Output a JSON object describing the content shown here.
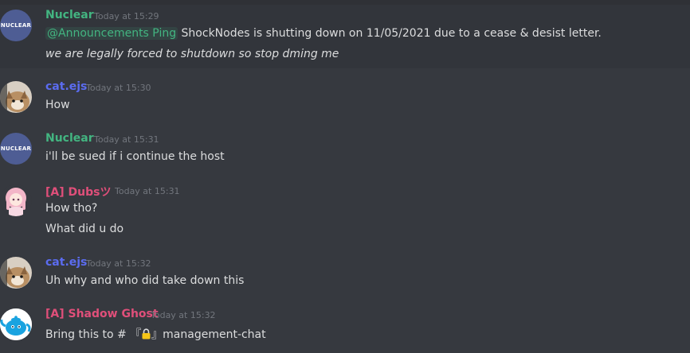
{
  "messages": [
    {
      "author": "Nuclear",
      "author_color": "#43b581",
      "timestamp": "Today at 15:29",
      "avatar_text": "NUCLEAR",
      "mention": "@Announcements Ping",
      "line1": " ShockNodes is shutting down on 11/05/2021 due to a cease & desist letter.",
      "line2": "we are legally forced to shutdown so stop dming me"
    },
    {
      "author": "cat.ejs",
      "author_color": "#5b6cf0",
      "timestamp": "Today at 15:30",
      "line1": "How"
    },
    {
      "author": "Nuclear",
      "author_color": "#43b581",
      "timestamp": "Today at 15:31",
      "avatar_text": "NUCLEAR",
      "line1": "i'll be sued if i continue the host"
    },
    {
      "author": "[A] Dubsツ",
      "author_color": "#e04f7a",
      "timestamp": "Today at 15:31",
      "line1": "How tho?",
      "line2": "What did u do"
    },
    {
      "author": "cat.ejs",
      "author_color": "#5b6cf0",
      "timestamp": "Today at 15:32",
      "line1": "Uh why and who did take down this"
    },
    {
      "author": "[A] Shadow Ghost",
      "author_color": "#e04f7a",
      "timestamp": "Today at 15:32",
      "channel_prefix": "Bring this to # 『",
      "channel_suffix": "』management-chat"
    }
  ]
}
